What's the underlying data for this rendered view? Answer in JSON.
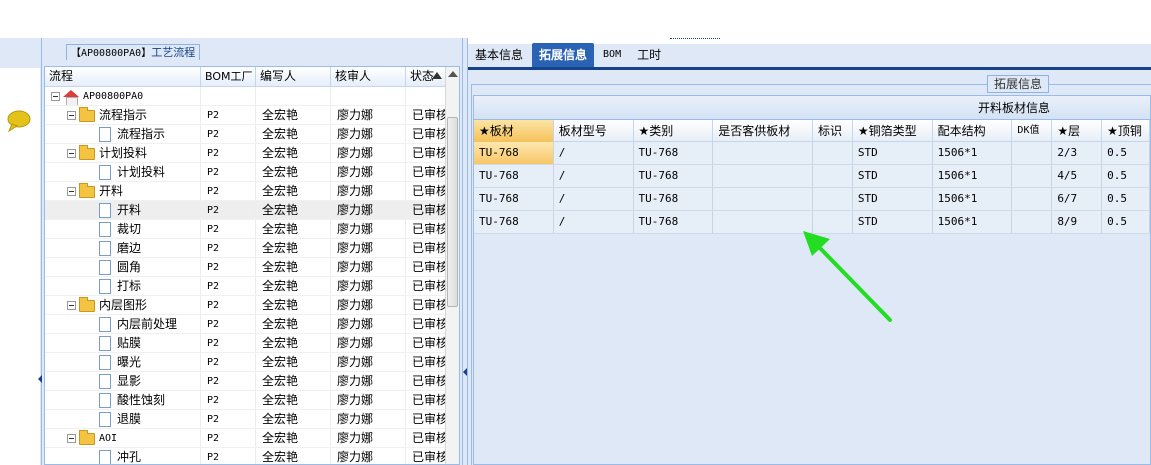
{
  "left_panel": {
    "legend_code": "【AP00800PA0】",
    "legend_title": "工艺流程",
    "columns": [
      "流程",
      "BOM工厂",
      "编写人",
      "核审人",
      "状态"
    ],
    "root": "AP00800PA0",
    "rows": [
      {
        "name": "流程指示",
        "type": "folder",
        "level": 1,
        "bom": "P2",
        "author": "全宏艳",
        "reviewer": "廖力娜",
        "status": "已审核"
      },
      {
        "name": "流程指示",
        "type": "doc",
        "level": 2,
        "bom": "P2",
        "author": "全宏艳",
        "reviewer": "廖力娜",
        "status": "已审核"
      },
      {
        "name": "计划投料",
        "type": "folder",
        "level": 1,
        "bom": "P2",
        "author": "全宏艳",
        "reviewer": "廖力娜",
        "status": "已审核"
      },
      {
        "name": "计划投料",
        "type": "doc",
        "level": 2,
        "bom": "P2",
        "author": "全宏艳",
        "reviewer": "廖力娜",
        "status": "已审核"
      },
      {
        "name": "开料",
        "type": "folder",
        "level": 1,
        "bom": "P2",
        "author": "全宏艳",
        "reviewer": "廖力娜",
        "status": "已审核"
      },
      {
        "name": "开料",
        "type": "doc",
        "level": 2,
        "bom": "P2",
        "author": "全宏艳",
        "reviewer": "廖力娜",
        "status": "已审核",
        "selected": true
      },
      {
        "name": "裁切",
        "type": "doc",
        "level": 2,
        "bom": "P2",
        "author": "全宏艳",
        "reviewer": "廖力娜",
        "status": "已审核"
      },
      {
        "name": "磨边",
        "type": "doc",
        "level": 2,
        "bom": "P2",
        "author": "全宏艳",
        "reviewer": "廖力娜",
        "status": "已审核"
      },
      {
        "name": "圆角",
        "type": "doc",
        "level": 2,
        "bom": "P2",
        "author": "全宏艳",
        "reviewer": "廖力娜",
        "status": "已审核"
      },
      {
        "name": "打标",
        "type": "doc",
        "level": 2,
        "bom": "P2",
        "author": "全宏艳",
        "reviewer": "廖力娜",
        "status": "已审核"
      },
      {
        "name": "内层图形",
        "type": "folder",
        "level": 1,
        "bom": "P2",
        "author": "全宏艳",
        "reviewer": "廖力娜",
        "status": "已审核"
      },
      {
        "name": "内层前处理",
        "type": "doc",
        "level": 2,
        "bom": "P2",
        "author": "全宏艳",
        "reviewer": "廖力娜",
        "status": "已审核"
      },
      {
        "name": "贴膜",
        "type": "doc",
        "level": 2,
        "bom": "P2",
        "author": "全宏艳",
        "reviewer": "廖力娜",
        "status": "已审核"
      },
      {
        "name": "曝光",
        "type": "doc",
        "level": 2,
        "bom": "P2",
        "author": "全宏艳",
        "reviewer": "廖力娜",
        "status": "已审核"
      },
      {
        "name": "显影",
        "type": "doc",
        "level": 2,
        "bom": "P2",
        "author": "全宏艳",
        "reviewer": "廖力娜",
        "status": "已审核"
      },
      {
        "name": "酸性蚀刻",
        "type": "doc",
        "level": 2,
        "bom": "P2",
        "author": "全宏艳",
        "reviewer": "廖力娜",
        "status": "已审核"
      },
      {
        "name": "退膜",
        "type": "doc",
        "level": 2,
        "bom": "P2",
        "author": "全宏艳",
        "reviewer": "廖力娜",
        "status": "已审核"
      },
      {
        "name": "AOI",
        "type": "folder",
        "level": 1,
        "bom": "P2",
        "author": "全宏艳",
        "reviewer": "廖力娜",
        "status": "已审核"
      },
      {
        "name": "冲孔",
        "type": "doc",
        "level": 2,
        "bom": "P2",
        "author": "全宏艳",
        "reviewer": "廖力娜",
        "status": "已审核"
      }
    ]
  },
  "right_panel": {
    "tabs": [
      "基本信息",
      "拓展信息",
      "BOM",
      "工时"
    ],
    "active_tab": 1,
    "fieldset_legend": "拓展信息",
    "grid_title": "开料板材信息",
    "columns": [
      "★板材",
      "板材型号",
      "★类别",
      "是否客供板材",
      "标识",
      "★铜箔类型",
      "配本结构",
      "DK值",
      "★层",
      "★顶铜"
    ],
    "rows": [
      [
        "TU-768",
        "/",
        "TU-768",
        "",
        "",
        "STD",
        "1506*1",
        "",
        "2/3",
        "0.5"
      ],
      [
        "TU-768",
        "/",
        "TU-768",
        "",
        "",
        "STD",
        "1506*1",
        "",
        "4/5",
        "0.5"
      ],
      [
        "TU-768",
        "/",
        "TU-768",
        "",
        "",
        "STD",
        "1506*1",
        "",
        "6/7",
        "0.5"
      ],
      [
        "TU-768",
        "/",
        "TU-768",
        "",
        "",
        "STD",
        "1506*1",
        "",
        "8/9",
        "0.5"
      ]
    ]
  },
  "colors": {
    "panel_bg": "#dfe8f6",
    "border": "#99bbe8",
    "active_tab": "#2a63b4",
    "highlight": "#f8c667",
    "annotation_arrow": "#22dd22"
  },
  "icons": [
    "chat-bubble-icon",
    "home-icon",
    "folder-icon",
    "document-icon",
    "expander-icon",
    "sort-arrow-icon"
  ]
}
